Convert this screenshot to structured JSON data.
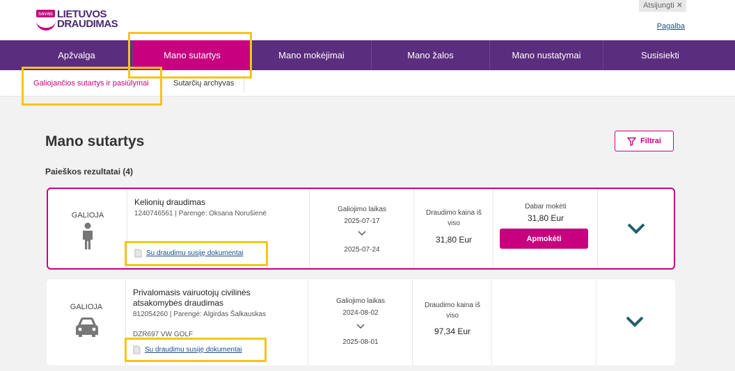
{
  "header": {
    "logo_badge": "savas",
    "logo_line1": "LIETUVOS",
    "logo_line2": "DRAUDIMAS",
    "logout_label": "Atsijungti ✕",
    "help_label": "Pagalba"
  },
  "nav": {
    "items": [
      "Apžvalga",
      "Mano sutartys",
      "Mano mokėjimai",
      "Mano žalos",
      "Mano nustatymai",
      "Susisiekti"
    ],
    "active_index": 1
  },
  "subnav": {
    "active": "Galiojančios sutartys ir pasiūlymai",
    "archive": "Sutarčių archyvas"
  },
  "page": {
    "title": "Mano sutartys",
    "results": "Paieškos rezultatai (4)",
    "filter_label": "Filtrai"
  },
  "contracts": [
    {
      "status": "GALIOJA",
      "icon": "person-icon",
      "name": "Kelionių draudimas",
      "meta": "1240746561 | Parengė: Oksana Norušienė",
      "docs_label": "Su draudimu susiję dokumentai",
      "validity_label": "Galiojimo laikas",
      "date_from": "2025-07-17",
      "date_to": "2025-07-24",
      "price_label": "Draudimo kaina iš viso",
      "price": "31,80 Eur",
      "pay_label": "Dabar mokėti",
      "pay_amount": "31,80 Eur",
      "pay_button": "Apmokėti"
    },
    {
      "status": "GALIOJA",
      "icon": "car-icon",
      "name": "Privalomasis vairuotojų civilinės atsakomybės draudimas",
      "meta": "812054260 | Parengė: Algirdas Šalkauskas",
      "plate": "DZR697 VW GOLF",
      "docs_label": "Su draudimu susiję dokumentai",
      "validity_label": "Galiojimo laikas",
      "date_from": "2024-08-02",
      "date_to": "2025-08-01",
      "price_label": "Draudimo kaina iš viso",
      "price": "97,34 Eur"
    }
  ],
  "colors": {
    "brand_purple": "#5b2d7e",
    "brand_magenta": "#c8007f",
    "chevron_teal": "#1f5f6e",
    "highlight_yellow": "#f5c518"
  }
}
